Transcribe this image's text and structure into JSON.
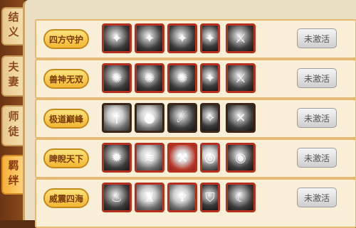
{
  "tabs": [
    {
      "label": "结义",
      "active": false
    },
    {
      "label": "夫妻",
      "active": false
    },
    {
      "label": "师徒",
      "active": false
    },
    {
      "label": "羁绊",
      "active": true
    }
  ],
  "rows": [
    {
      "name": "四方守护",
      "status": "未激活",
      "icons": [
        "dragon-head-icon",
        "dragon-head-icon",
        "dragon-head-icon",
        "dragon-head-icon",
        "warrior-icon"
      ]
    },
    {
      "name": "兽神无双",
      "status": "未激活",
      "icons": [
        "beast-head-icon",
        "fox-head-icon",
        "wolf-head-icon",
        "dragon-head-icon",
        "warrior-icon"
      ]
    },
    {
      "name": "极道巅峰",
      "status": "未激活",
      "icons": [
        "sword-icon",
        "orb-icon",
        "fire-ball-icon",
        "wing-icon",
        "blade-icon"
      ]
    },
    {
      "name": "睥睨天下",
      "status": "未激活",
      "icons": [
        "burst-icon",
        "fan-icon",
        "hammer-icon",
        "spiral-icon",
        "eye-icon"
      ]
    },
    {
      "name": "威震四海",
      "status": "未激活",
      "icons": [
        "flame-icon",
        "statue-icon",
        "goblet-icon",
        "shield-icon",
        "horn-icon"
      ]
    }
  ]
}
